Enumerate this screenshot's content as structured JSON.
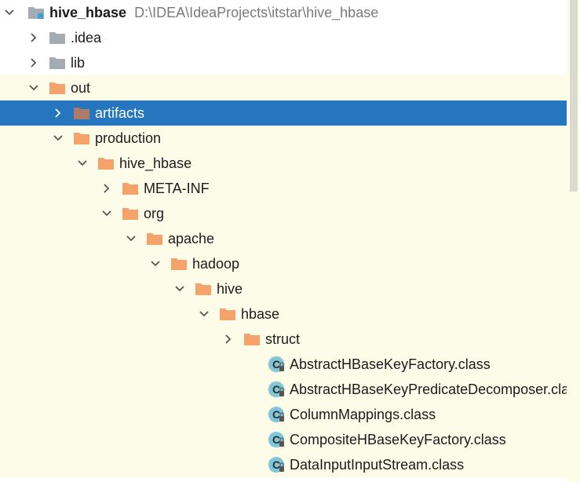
{
  "project": {
    "name": "hive_hbase",
    "path": "D:\\IDEA\\IdeaProjects\\itstar\\hive_hbase"
  },
  "tree": [
    {
      "label": ".idea",
      "type": "folder-gray",
      "state": "collapsed"
    },
    {
      "label": "lib",
      "type": "folder-gray",
      "state": "collapsed"
    },
    {
      "label": "out",
      "type": "folder-orange",
      "state": "expanded"
    },
    {
      "label": "artifacts",
      "type": "folder-brown",
      "state": "collapsed",
      "selected": true
    },
    {
      "label": "production",
      "type": "folder-orange",
      "state": "expanded"
    },
    {
      "label": "hive_hbase",
      "type": "folder-orange",
      "state": "expanded"
    },
    {
      "label": "META-INF",
      "type": "folder-orange",
      "state": "collapsed"
    },
    {
      "label": "org",
      "type": "folder-orange",
      "state": "expanded"
    },
    {
      "label": "apache",
      "type": "folder-orange",
      "state": "expanded"
    },
    {
      "label": "hadoop",
      "type": "folder-orange",
      "state": "expanded"
    },
    {
      "label": "hive",
      "type": "folder-orange",
      "state": "expanded"
    },
    {
      "label": "hbase",
      "type": "folder-orange",
      "state": "expanded"
    },
    {
      "label": "struct",
      "type": "folder-orange",
      "state": "collapsed"
    },
    {
      "label": "AbstractHBaseKeyFactory.class",
      "type": "class-abstract",
      "state": "leaf"
    },
    {
      "label": "AbstractHBaseKeyPredicateDecomposer.class",
      "type": "class-abstract",
      "state": "leaf"
    },
    {
      "label": "ColumnMappings.class",
      "type": "class",
      "state": "leaf"
    },
    {
      "label": "CompositeHBaseKeyFactory.class",
      "type": "class",
      "state": "leaf"
    },
    {
      "label": "DataInputInputStream.class",
      "type": "class",
      "state": "leaf"
    }
  ],
  "colors": {
    "selection": "#2675bf",
    "tint": "#fdfce8",
    "folder_orange": "#f5a36b",
    "folder_gray": "#a3abb3",
    "folder_brown": "#b07a68",
    "class_badge": "#7fc7d6"
  }
}
